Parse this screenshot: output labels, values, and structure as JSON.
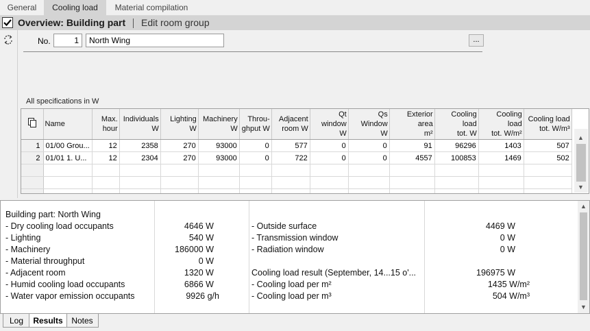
{
  "tabs": [
    "General",
    "Cooling load",
    "Material compilation"
  ],
  "header": {
    "title": "Overview: Building part",
    "edit_link": "Edit room group"
  },
  "form": {
    "no_label": "No.",
    "no_value": "1",
    "name_value": "North Wing",
    "more_button": "..."
  },
  "spec_label": "All specifications in W",
  "grid": {
    "columns": [
      {
        "l1": "Name",
        "l2": ""
      },
      {
        "l1": "Max.",
        "l2": "hour"
      },
      {
        "l1": "Individuals",
        "l2": "W"
      },
      {
        "l1": "Lighting",
        "l2": "W"
      },
      {
        "l1": "Machinery",
        "l2": "W"
      },
      {
        "l1": "Throu-",
        "l2": "ghput W"
      },
      {
        "l1": "Adjacent",
        "l2": "room W"
      },
      {
        "l1": "Qt window",
        "l2": "W"
      },
      {
        "l1": "Qs Window",
        "l2": "W"
      },
      {
        "l1": "Exterior area",
        "l2": "m²"
      },
      {
        "l1": "Cooling load",
        "l2": "tot. W"
      },
      {
        "l1": "Cooling load",
        "l2": "tot. W/m²"
      },
      {
        "l1": "Cooling load",
        "l2": "tot. W/m³"
      }
    ],
    "rows": [
      [
        "1",
        "01/00 Grou...",
        "12",
        "2358",
        "270",
        "93000",
        "0",
        "577",
        "0",
        "0",
        "91",
        "96296",
        "1403",
        "507"
      ],
      [
        "2",
        "01/01 1. U...",
        "12",
        "2304",
        "270",
        "93000",
        "0",
        "722",
        "0",
        "0",
        "4557",
        "100853",
        "1469",
        "502"
      ]
    ]
  },
  "results": {
    "left": [
      {
        "label": "Building part: North Wing",
        "value": ""
      },
      {
        "label": "- Dry cooling load occupants",
        "value": "4646 W"
      },
      {
        "label": "- Lighting",
        "value": "540 W"
      },
      {
        "label": "- Machinery",
        "value": "186000 W"
      },
      {
        "label": "- Material throughput",
        "value": "0 W"
      },
      {
        "label": "- Adjacent room",
        "value": "1320 W"
      },
      {
        "label": "- Humid cooling load occupants",
        "value": "6866 W"
      },
      {
        "label": "- Water vapor emission occupants",
        "value": "9926 g/h"
      }
    ],
    "right": [
      {
        "label": "",
        "value": ""
      },
      {
        "label": "- Outside surface",
        "value": "4469 W"
      },
      {
        "label": "- Transmission window",
        "value": "0 W"
      },
      {
        "label": "- Radiation window",
        "value": "0 W"
      },
      {
        "label": "",
        "value": ""
      },
      {
        "label": "Cooling load result (September, 14...15 o'...",
        "value": "196975 W"
      },
      {
        "label": "- Cooling load per m²",
        "value": "1435 W/m²"
      },
      {
        "label": "- Cooling load per m³",
        "value": "504 W/m³"
      }
    ]
  },
  "bottom_tabs": [
    "Log",
    "Results",
    "Notes"
  ]
}
